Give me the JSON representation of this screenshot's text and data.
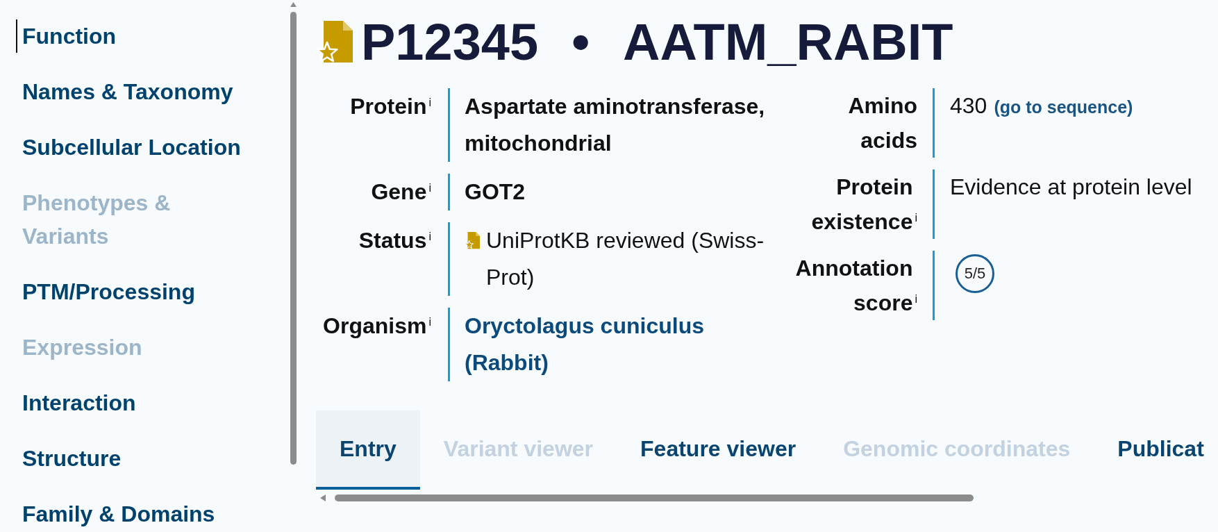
{
  "sidebar": {
    "items": [
      {
        "label": "Function",
        "selected": true,
        "disabled": false
      },
      {
        "label": "Names & Taxonomy",
        "selected": false,
        "disabled": false
      },
      {
        "label": "Subcellular Location",
        "selected": false,
        "disabled": false
      },
      {
        "label": "Phenotypes & Variants",
        "selected": false,
        "disabled": true
      },
      {
        "label": "PTM/Processing",
        "selected": false,
        "disabled": false
      },
      {
        "label": "Expression",
        "selected": false,
        "disabled": true
      },
      {
        "label": "Interaction",
        "selected": false,
        "disabled": false
      },
      {
        "label": "Structure",
        "selected": false,
        "disabled": false
      },
      {
        "label": "Family & Domains",
        "selected": false,
        "disabled": false
      }
    ]
  },
  "header": {
    "accession": "P12345",
    "separator": "•",
    "entry_name": "AATM_RABIT"
  },
  "summary": {
    "left": [
      {
        "label": "Protein",
        "info": "i",
        "kind": "strong",
        "value": "Aspartate aminotransferase, mitochondrial"
      },
      {
        "label": "Gene",
        "info": "i",
        "kind": "strong",
        "value": "GOT2"
      },
      {
        "label": "Status",
        "info": "i",
        "kind": "status",
        "value": "UniProtKB reviewed (Swiss-Prot)"
      },
      {
        "label": "Organism",
        "info": "i",
        "kind": "link",
        "value": "Oryctolagus cuniculus (Rabbit)"
      }
    ],
    "right": [
      {
        "label": "Amino acids",
        "kind": "length",
        "value": "430",
        "link": "(go to sequence)"
      },
      {
        "label": "Protein existence",
        "info": "i",
        "kind": "plain",
        "value": "Evidence at protein level"
      },
      {
        "label": "Annotation score",
        "info": "i",
        "kind": "score",
        "value": "5/5"
      }
    ]
  },
  "tabs": [
    {
      "label": "Entry",
      "selected": true,
      "disabled": false
    },
    {
      "label": "Variant viewer",
      "selected": false,
      "disabled": true
    },
    {
      "label": "Feature viewer",
      "selected": false,
      "disabled": false
    },
    {
      "label": "Genomic coordinates",
      "selected": false,
      "disabled": true
    },
    {
      "label": "Publicat",
      "selected": false,
      "disabled": false
    }
  ]
}
